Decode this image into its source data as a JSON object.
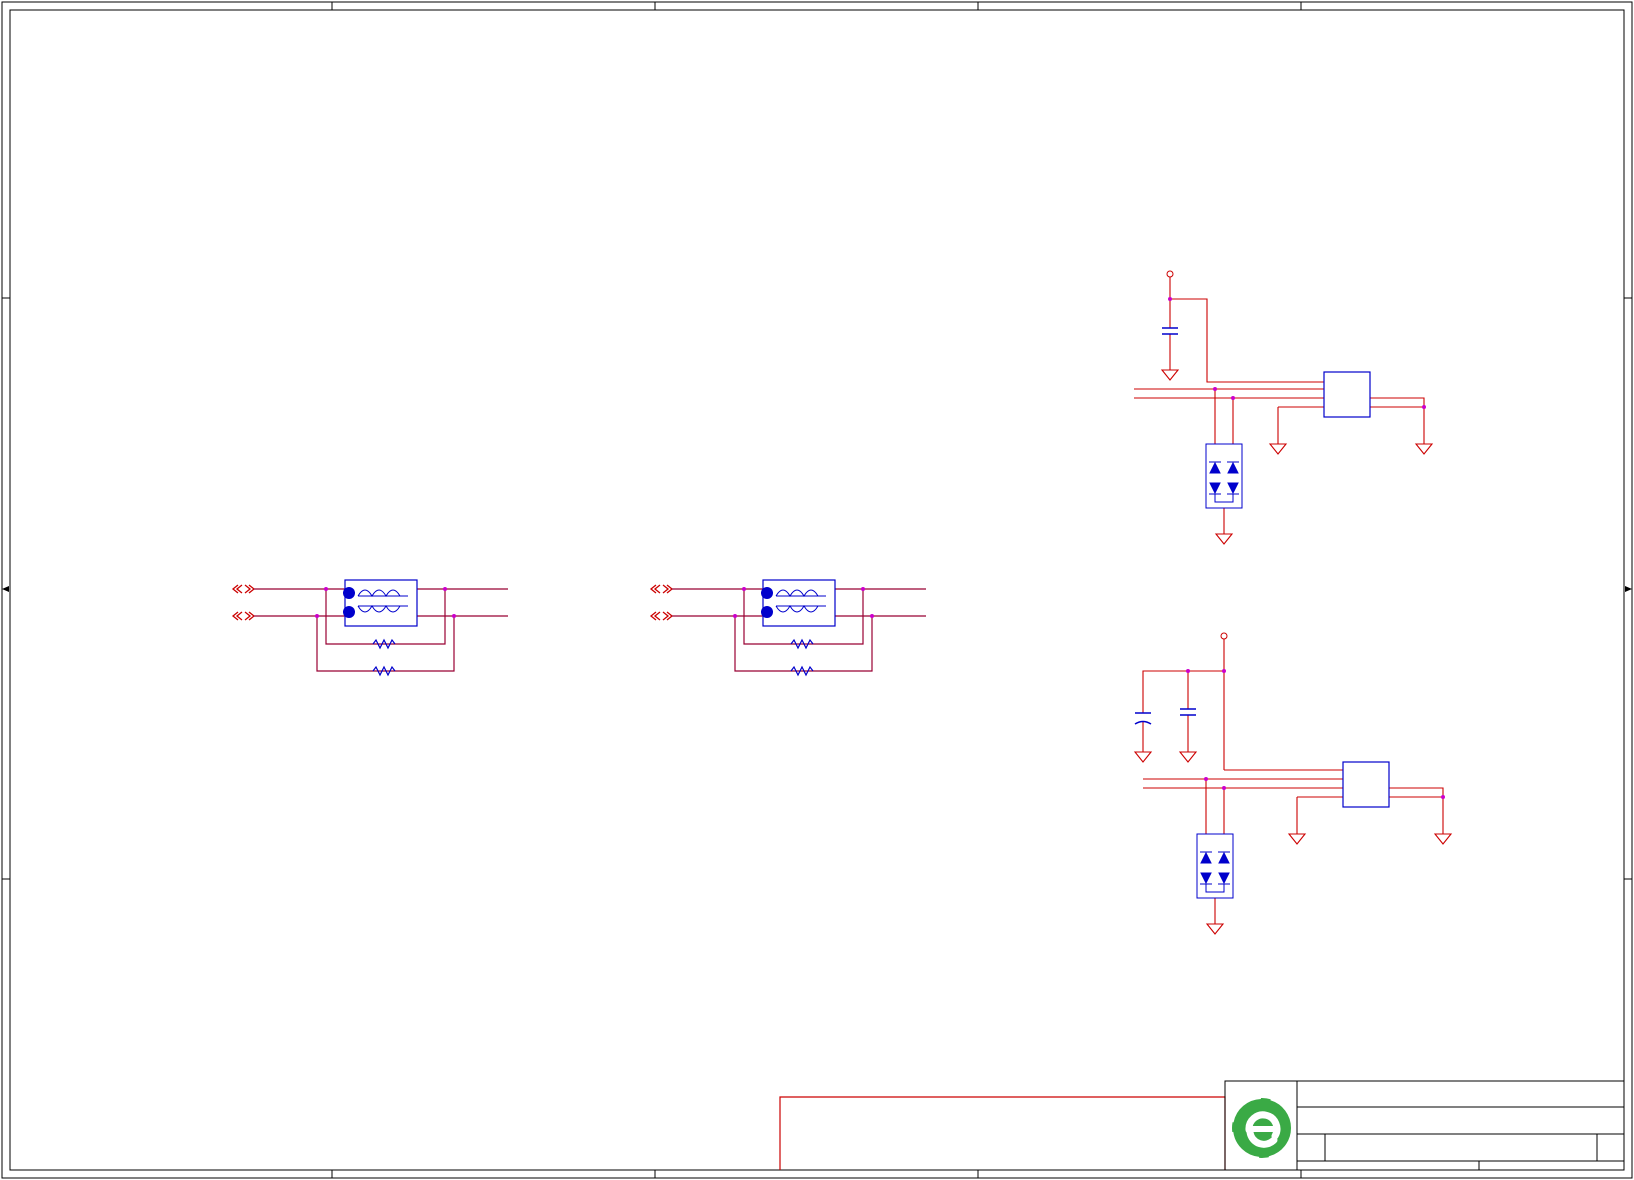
{
  "sheet": {
    "title": "",
    "colors": {
      "frame": "#000000",
      "wire": "#cc0000",
      "bus": "#990033",
      "component": "#0000cc",
      "junction": "#cc00cc",
      "logo_green": "#33aa44"
    },
    "logo": {
      "icon": "company-logo-icon"
    }
  },
  "icons": {
    "ground": "ground-symbol-icon",
    "capacitor": "capacitor-symbol-icon",
    "resistor": "resistor-symbol-icon",
    "tvs": "tvs-diode-array-icon",
    "choke": "common-mode-choke-icon",
    "connector": "offsheet-connector-icon",
    "power": "power-pin-icon"
  }
}
